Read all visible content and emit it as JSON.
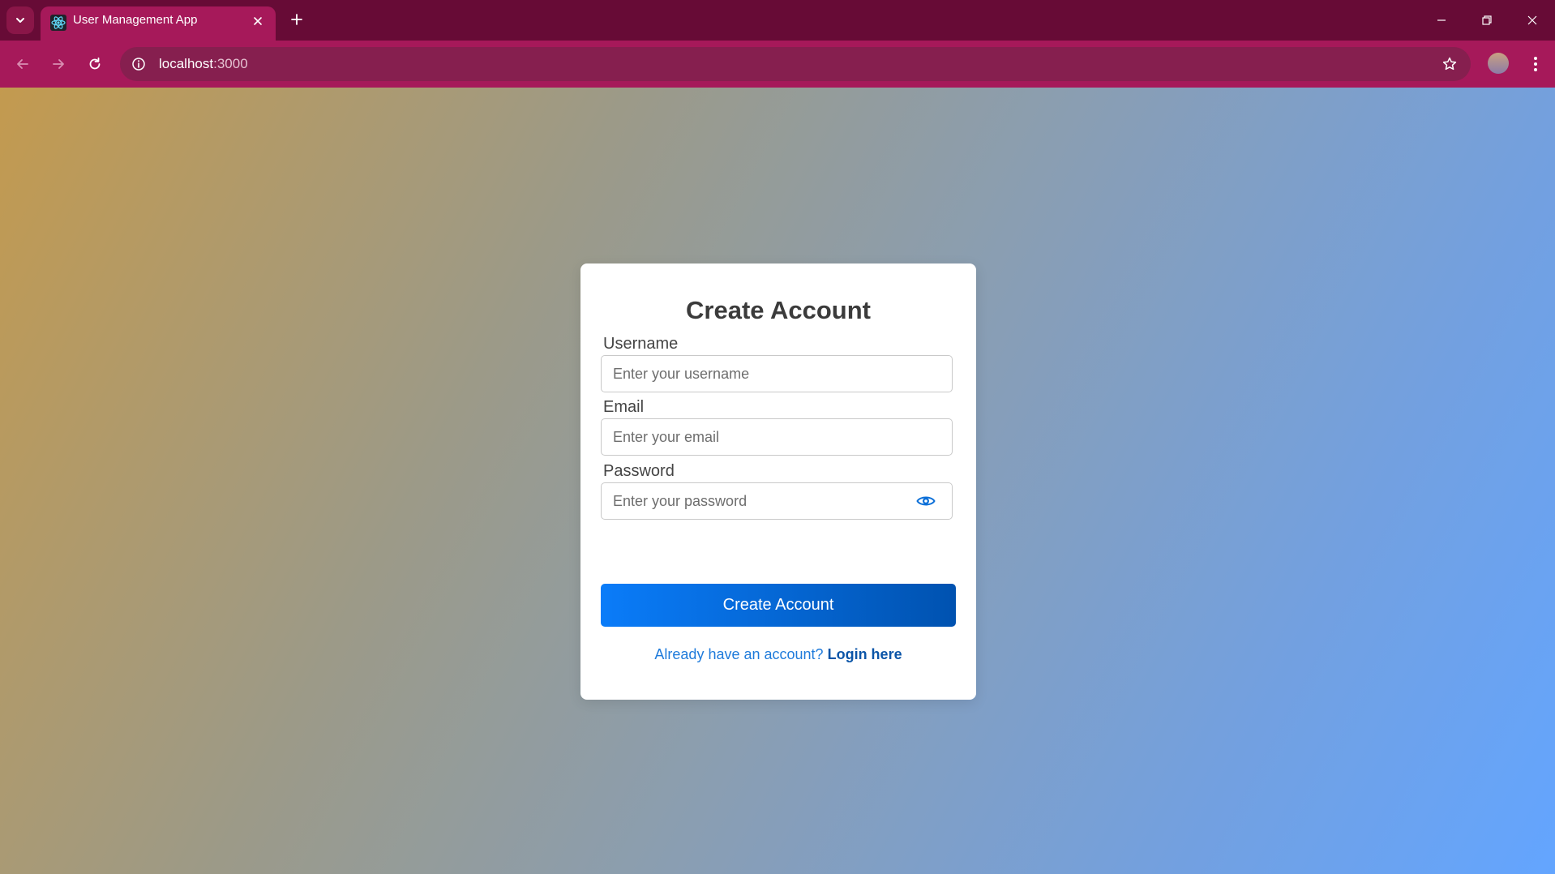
{
  "browser": {
    "tab": {
      "title": "User Management App",
      "favicon": "react-atom-icon"
    },
    "address_bar": {
      "host": "localhost",
      "port": ":3000"
    }
  },
  "form": {
    "title": "Create Account",
    "username": {
      "label": "Username",
      "placeholder": "Enter your username",
      "value": ""
    },
    "email": {
      "label": "Email",
      "placeholder": "Enter your email",
      "value": ""
    },
    "password": {
      "label": "Password",
      "placeholder": "Enter your password",
      "value": "",
      "toggle_icon": "eye-icon"
    },
    "submit_label": "Create Account",
    "login_prompt": "Already have an account?",
    "login_link": "Login here"
  },
  "colors": {
    "tabstrip": "#670b36",
    "toolbar": "#a6195a",
    "button_start": "#0a7cf9",
    "button_end": "#0052b0",
    "link": "#0b55a8"
  }
}
